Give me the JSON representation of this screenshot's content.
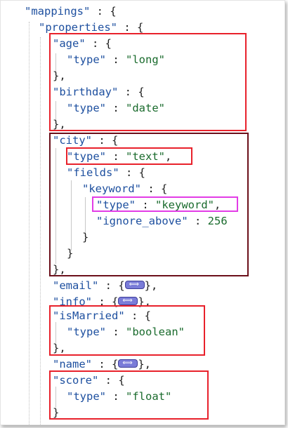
{
  "lines": {
    "mappings": {
      "key": "\"mappings\"",
      "punc": " : {"
    },
    "properties": {
      "key": "\"properties\"",
      "punc": " : {"
    },
    "age": {
      "key": "\"age\"",
      "punc": " : {"
    },
    "age_type": {
      "key": "\"type\"",
      "sep": " : ",
      "val": "\"long\""
    },
    "age_close": {
      "punc": "},"
    },
    "birthday": {
      "key": "\"birthday\"",
      "punc": " : {"
    },
    "birthday_type": {
      "key": "\"type\"",
      "sep": " : ",
      "val": "\"date\""
    },
    "birthday_close": {
      "punc": "},"
    },
    "city": {
      "key": "\"city\"",
      "punc": " : {"
    },
    "city_type": {
      "key": "\"type\"",
      "sep": " : ",
      "val": "\"text\"",
      "tail": ","
    },
    "fields": {
      "key": "\"fields\"",
      "punc": " : {"
    },
    "keyword": {
      "key": "\"keyword\"",
      "punc": " : {"
    },
    "keyword_type": {
      "key": "\"type\"",
      "sep": " : ",
      "val": "\"keyword\"",
      "tail": ","
    },
    "ignore_above": {
      "key": "\"ignore_above\"",
      "sep": " : ",
      "val": "256"
    },
    "keyword_close": {
      "punc": "}"
    },
    "fields_close": {
      "punc": "}"
    },
    "city_close": {
      "punc": "},"
    },
    "email": {
      "key": "\"email\"",
      "sep": " : {",
      "tail": "},"
    },
    "info": {
      "key": "\"info\"",
      "sep": " : {",
      "tail": "},"
    },
    "isMarried": {
      "key": "\"isMarried\"",
      "punc": " : {"
    },
    "isMarried_type": {
      "key": "\"type\"",
      "sep": " : ",
      "val": "\"boolean\""
    },
    "isMarried_close": {
      "punc": "},"
    },
    "name": {
      "key": "\"name\"",
      "sep": " : {",
      "tail": "},"
    },
    "score": {
      "key": "\"score\"",
      "punc": " : {"
    },
    "score_type": {
      "key": "\"type\"",
      "sep": " : ",
      "val": "\"float\""
    },
    "score_close": {
      "punc": "}"
    }
  },
  "colors": {
    "key": "#1d4f9f",
    "string": "#1a6b2d",
    "highlight_red": "#e8212b",
    "highlight_dark": "#6b0f1a",
    "highlight_magenta": "#e23ce6",
    "collapse_badge": "#7a7cd8"
  },
  "icons": {
    "collapsed_object": "collapsed-object-icon"
  }
}
